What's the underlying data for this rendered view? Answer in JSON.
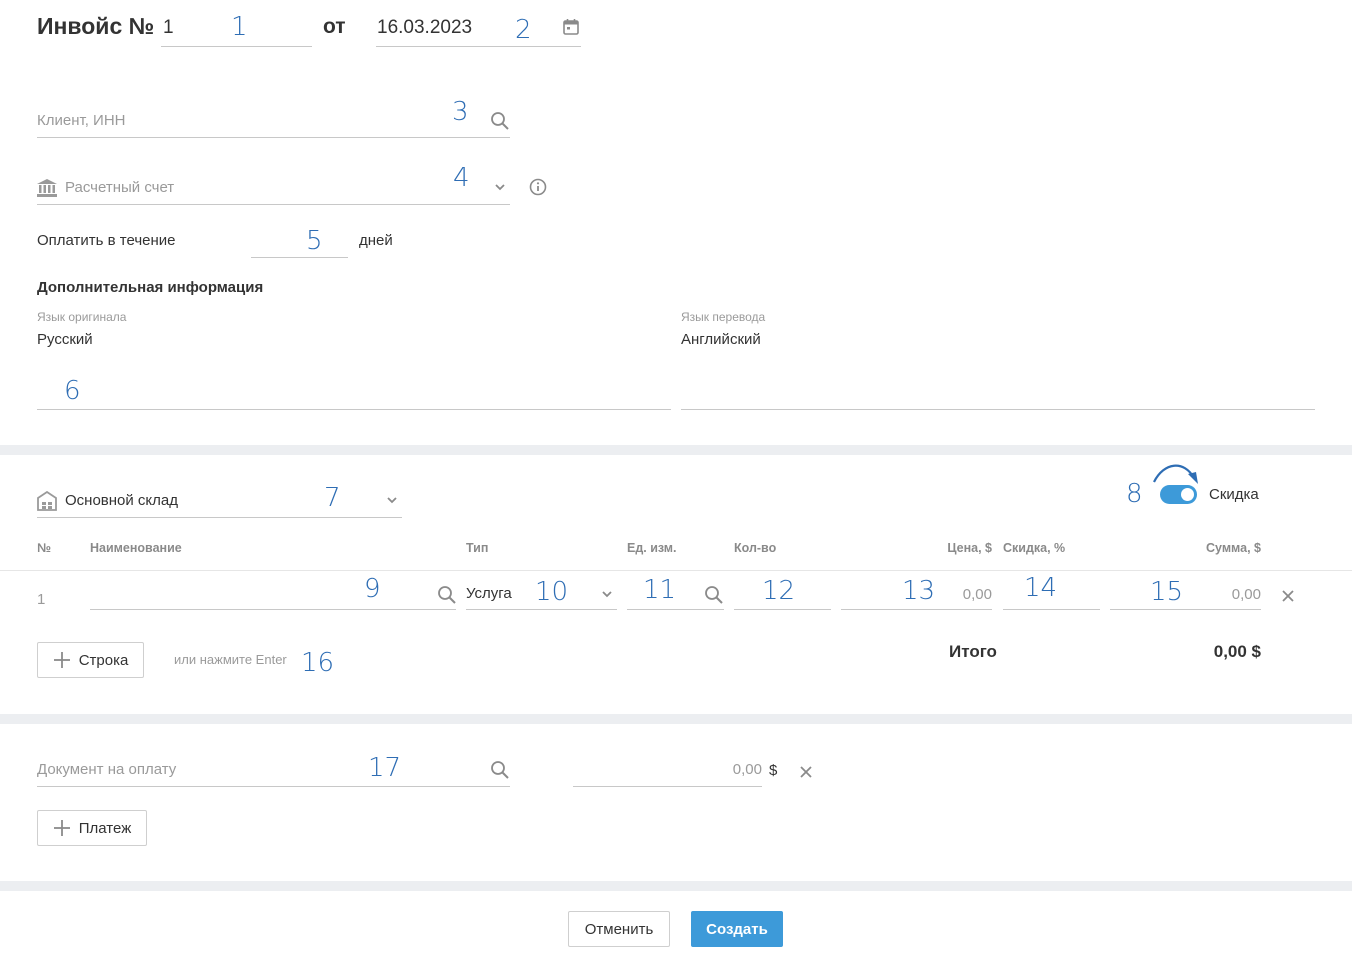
{
  "header": {
    "title": "Инвойс №",
    "invoice_number": "1",
    "from_label": "от",
    "date": "16.03.2023"
  },
  "client": {
    "placeholder": "Клиент, ИНН"
  },
  "account": {
    "placeholder": "Расчетный счет"
  },
  "payment_term": {
    "prefix": "Оплатить в течение",
    "suffix": "дней"
  },
  "additional": {
    "heading": "Дополнительная информация",
    "original_lang_label": "Язык оригинала",
    "original_lang_value": "Русский",
    "translation_lang_label": "Язык перевода",
    "translation_lang_value": "Английский"
  },
  "warehouse": {
    "value": "Основной склад"
  },
  "discount_toggle": {
    "label": "Скидка",
    "on": true
  },
  "table": {
    "headers": [
      "№",
      "Наименование",
      "Тип",
      "Ед. изм.",
      "Кол-во",
      "Цена, $",
      "Скидка, %",
      "Сумма, $"
    ],
    "row": {
      "index": "1",
      "type": "Услуга",
      "price": "0,00",
      "sum": "0,00"
    }
  },
  "add_row": {
    "button": "Строка",
    "hint": "или нажмите Enter"
  },
  "total": {
    "label": "Итого",
    "value": "0,00 $"
  },
  "payment": {
    "doc_placeholder": "Документ на оплату",
    "amount": "0,00",
    "currency": "$",
    "add_button": "Платеж"
  },
  "footer": {
    "cancel": "Отменить",
    "create": "Создать"
  },
  "annotations": [
    "1",
    "2",
    "3",
    "4",
    "5",
    "6",
    "7",
    "8",
    "9",
    "10",
    "11",
    "12",
    "13",
    "14",
    "15",
    "16",
    "17"
  ],
  "colors": {
    "accent": "#3d9ad9",
    "annotation": "#2e6db4",
    "separator": "#eceef1"
  },
  "icons": [
    "calendar-icon",
    "search-icon",
    "bank-icon",
    "chevron-down-icon",
    "info-icon",
    "warehouse-icon",
    "close-icon",
    "plus-icon",
    "arrow-curve-icon"
  ]
}
